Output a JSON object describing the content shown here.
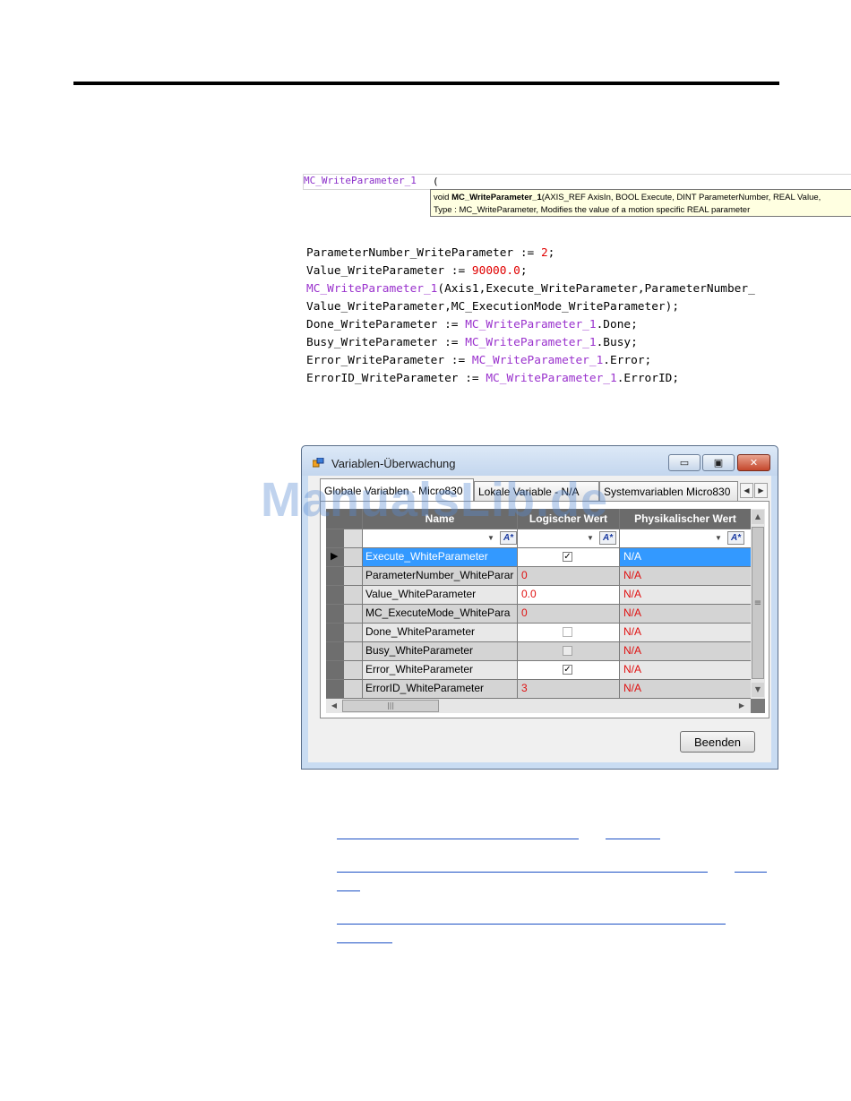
{
  "editor": {
    "typed_text": "MC_WriteParameter_1",
    "caret": "(",
    "tooltip_line1_prefix": "void ",
    "tooltip_line1_bold": "MC_WriteParameter_1",
    "tooltip_line1_rest": "(AXIS_REF AxisIn, BOOL Execute, DINT ParameterNumber, REAL Value,",
    "tooltip_line2": "Type : MC_WriteParameter, Modifies the value of a motion specific REAL parameter"
  },
  "code": {
    "l1a": "ParameterNumber_WriteParameter := ",
    "l1n": "2",
    "l1b": ";",
    "l2a": "Value_WriteParameter := ",
    "l2n": "90000.0",
    "l2b": ";",
    "l3fb": "MC_WriteParameter_1",
    "l3b": "(Axis1,Execute_WriteParameter,ParameterNumber_",
    "l4": "Value_WriteParameter,MC_ExecutionMode_WriteParameter);",
    "l5a": "Done_WriteParameter := ",
    "l5fb": "MC_WriteParameter_1",
    "l5b": ".Done;",
    "l6a": "Busy_WriteParameter := ",
    "l6fb": "MC_WriteParameter_1",
    "l6b": ".Busy;",
    "l7a": "Error_WriteParameter := ",
    "l7fb": "MC_WriteParameter_1",
    "l7b": ".Error;",
    "l8a": "ErrorID_WriteParameter := ",
    "l8fb": "MC_WriteParameter_1",
    "l8b": ".ErrorID;"
  },
  "window": {
    "title": "Variablen-Überwachung",
    "min_symbol": "▭",
    "max_symbol": "▣",
    "close_symbol": "✕",
    "tabs": [
      "Globale Variablen - Micro830",
      "Lokale Variable - N/A",
      "Systemvariablen Micro830"
    ],
    "tab_left": "◀",
    "tab_right": "▶",
    "columns": [
      "Name",
      "Logischer Wert",
      "Physikalischer Wert"
    ],
    "filter_symbol": "A*",
    "rows": [
      {
        "name": "Execute_WhiteParameter",
        "logical": "",
        "checkbox": "checked",
        "physical": "N/A"
      },
      {
        "name": "ParameterNumber_WhiteParar",
        "logical": "0",
        "checkbox": "",
        "physical": "N/A"
      },
      {
        "name": "Value_WhiteParameter",
        "logical": "0.0",
        "checkbox": "",
        "physical": "N/A"
      },
      {
        "name": "MC_ExecuteMode_WhitePara",
        "logical": "0",
        "checkbox": "",
        "physical": "N/A"
      },
      {
        "name": "Done_WhiteParameter",
        "logical": "",
        "checkbox": "unchecked",
        "physical": "N/A"
      },
      {
        "name": "Busy_WhiteParameter",
        "logical": "",
        "checkbox": "unchecked",
        "physical": "N/A"
      },
      {
        "name": "Error_WhiteParameter",
        "logical": "",
        "checkbox": "checked",
        "physical": "N/A"
      },
      {
        "name": "ErrorID_WhiteParameter",
        "logical": "3",
        "checkbox": "",
        "physical": "N/A"
      }
    ],
    "check_mark": "✓",
    "row_pointer": "▶",
    "scroll_grip": "≡",
    "hscroll_grip": "|||",
    "close_button": "Beenden"
  },
  "watermark": "ManualsLib.de",
  "colors": {
    "function_block": "#9a32cd",
    "number": "#e00000",
    "selection": "#3399ff",
    "link": "#1a4fc4"
  }
}
